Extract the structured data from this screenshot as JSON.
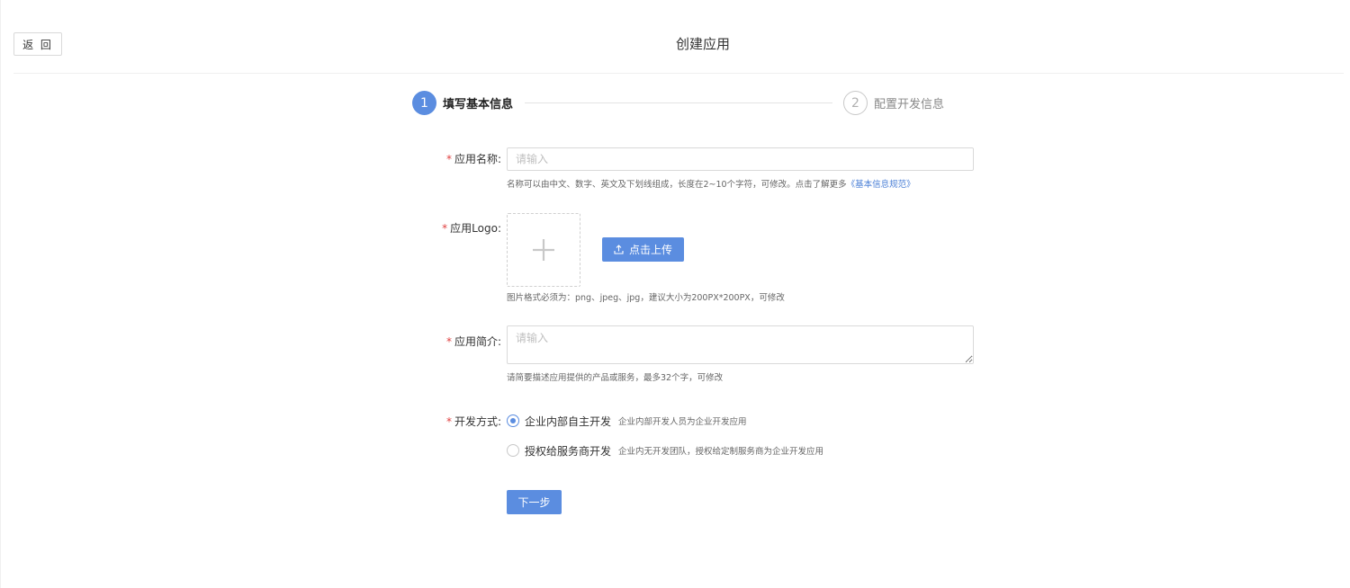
{
  "header": {
    "back_label": "返 回",
    "title": "创建应用"
  },
  "steps": [
    {
      "number": "1",
      "label": "填写基本信息",
      "active": true
    },
    {
      "number": "2",
      "label": "配置开发信息",
      "active": false
    }
  ],
  "form": {
    "app_name": {
      "label": "应用名称:",
      "placeholder": "请输入",
      "hint": "名称可以由中文、数字、英文及下划线组成，长度在2~10个字符，可修改。点击了解更多",
      "hint_link": "《基本信息规范》"
    },
    "app_logo": {
      "label": "应用Logo:",
      "upload_label": "点击上传",
      "hint": "图片格式必须为：png、jpeg、jpg，建议大小为200PX*200PX，可修改"
    },
    "app_intro": {
      "label": "应用简介:",
      "placeholder": "请输入",
      "hint": "请简要描述应用提供的产品或服务，最多32个字，可修改"
    },
    "dev_mode": {
      "label": "开发方式:",
      "options": [
        {
          "label": "企业内部自主开发",
          "desc": "企业内部开发人员为企业开发应用",
          "checked": true
        },
        {
          "label": "授权给服务商开发",
          "desc": "企业内无开发团队，授权给定制服务商为企业开发应用",
          "checked": false
        }
      ]
    },
    "required_mark": "*",
    "next_label": "下一步"
  },
  "colors": {
    "primary": "#5b8de0",
    "required": "#e04040",
    "link": "#4a7fd6"
  },
  "icons": {
    "upload": "upload-icon",
    "plus": "plus-icon"
  }
}
